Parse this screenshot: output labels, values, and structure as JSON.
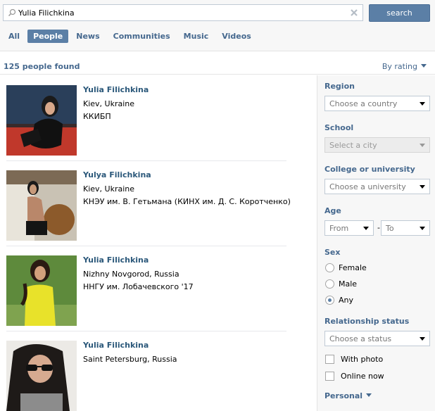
{
  "search": {
    "query": "Yulia Filichkina",
    "button_label": "search"
  },
  "tabs": [
    {
      "label": "All",
      "active": false
    },
    {
      "label": "People",
      "active": true
    },
    {
      "label": "News",
      "active": false
    },
    {
      "label": "Communities",
      "active": false
    },
    {
      "label": "Music",
      "active": false
    },
    {
      "label": "Videos",
      "active": false
    }
  ],
  "results": {
    "count_text": "125 people found",
    "sort_label": "By rating"
  },
  "people": [
    {
      "name": "Yulia Filichkina",
      "location": "Kiev, Ukraine",
      "education": "ККИБП"
    },
    {
      "name": "Yulya Filichkina",
      "location": "Kiev, Ukraine",
      "education": "КНЭУ им. В. Гетьмана (КИНХ им. Д. С. Коротченко)"
    },
    {
      "name": "Yulia Filichkina",
      "location": "Nizhny Novgorod, Russia",
      "education": "ННГУ им. Лобачевского '17"
    },
    {
      "name": "Yulia Filichkina",
      "location": "Saint Petersburg, Russia",
      "education": ""
    }
  ],
  "filters": {
    "region": {
      "label": "Region",
      "value": "Choose a country"
    },
    "school": {
      "label": "School",
      "value": "Select a city"
    },
    "college": {
      "label": "College or university",
      "value": "Choose a university"
    },
    "age": {
      "label": "Age",
      "from": "From",
      "to": "To",
      "separator": "-"
    },
    "sex": {
      "label": "Sex",
      "options": [
        "Female",
        "Male",
        "Any"
      ],
      "selected": "Any"
    },
    "relationship": {
      "label": "Relationship status",
      "value": "Choose a status"
    },
    "with_photo": "With photo",
    "online_now": "Online now",
    "personal": "Personal"
  }
}
